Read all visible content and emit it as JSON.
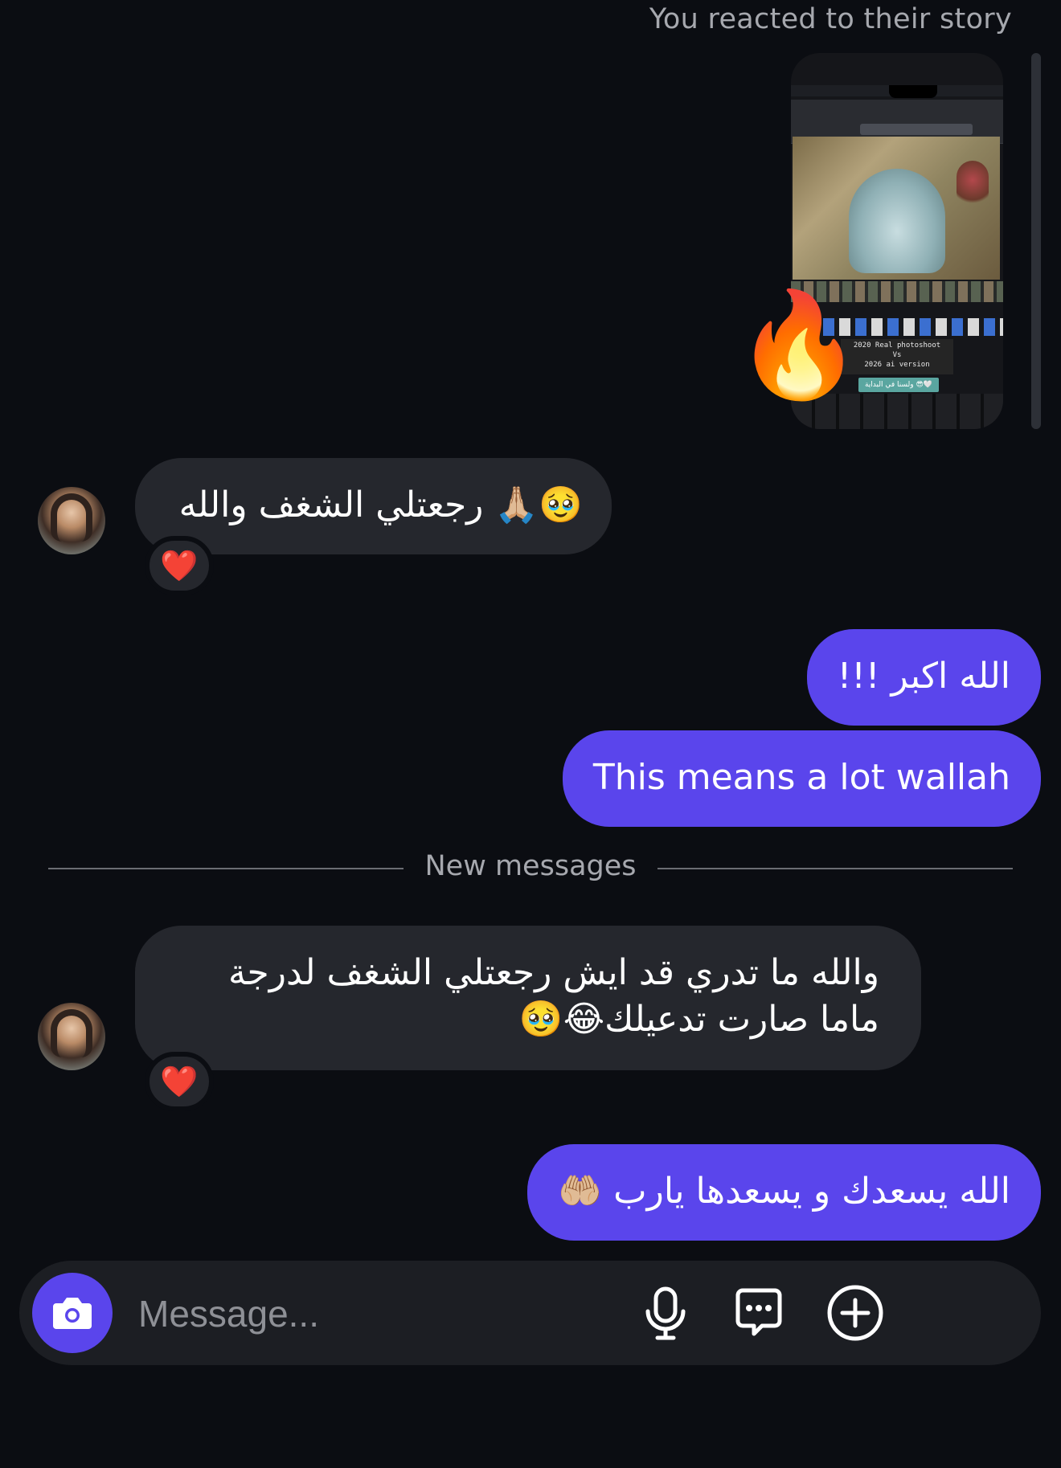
{
  "story": {
    "caption": "You reacted to their story",
    "thumb_text": "2020 Real photoshoot\nVs\n2026 ai version",
    "sticker_text": "ولسنا في البداية 😎🤍",
    "reaction_emoji": "🔥"
  },
  "messages": [
    {
      "dir": "in",
      "text": "🥹🙏🏼 رجعتلي الشغف والله",
      "reaction": "❤️"
    },
    {
      "dir": "out",
      "text": "الله اكبر !!!"
    },
    {
      "dir": "out",
      "text": "This means a lot wallah"
    },
    {
      "dir": "in",
      "text": "والله ما تدري قد ايش رجعتلي الشغف لدرجة ماما صارت تدعيلك😂🥹",
      "reaction": "❤️"
    },
    {
      "dir": "out",
      "text": "الله يسعدك و يسعدها يارب 🤲🏼"
    }
  ],
  "divider": {
    "label": "New messages"
  },
  "composer": {
    "placeholder": "Message...",
    "icons": [
      "camera-icon",
      "microphone-icon",
      "sticker-chat-icon",
      "add-circle-icon"
    ]
  },
  "colors": {
    "background": "#0b0d12",
    "outgoing_bubble": "#5a45ec",
    "incoming_bubble": "#25272d",
    "muted_text": "#a6a8ae"
  }
}
